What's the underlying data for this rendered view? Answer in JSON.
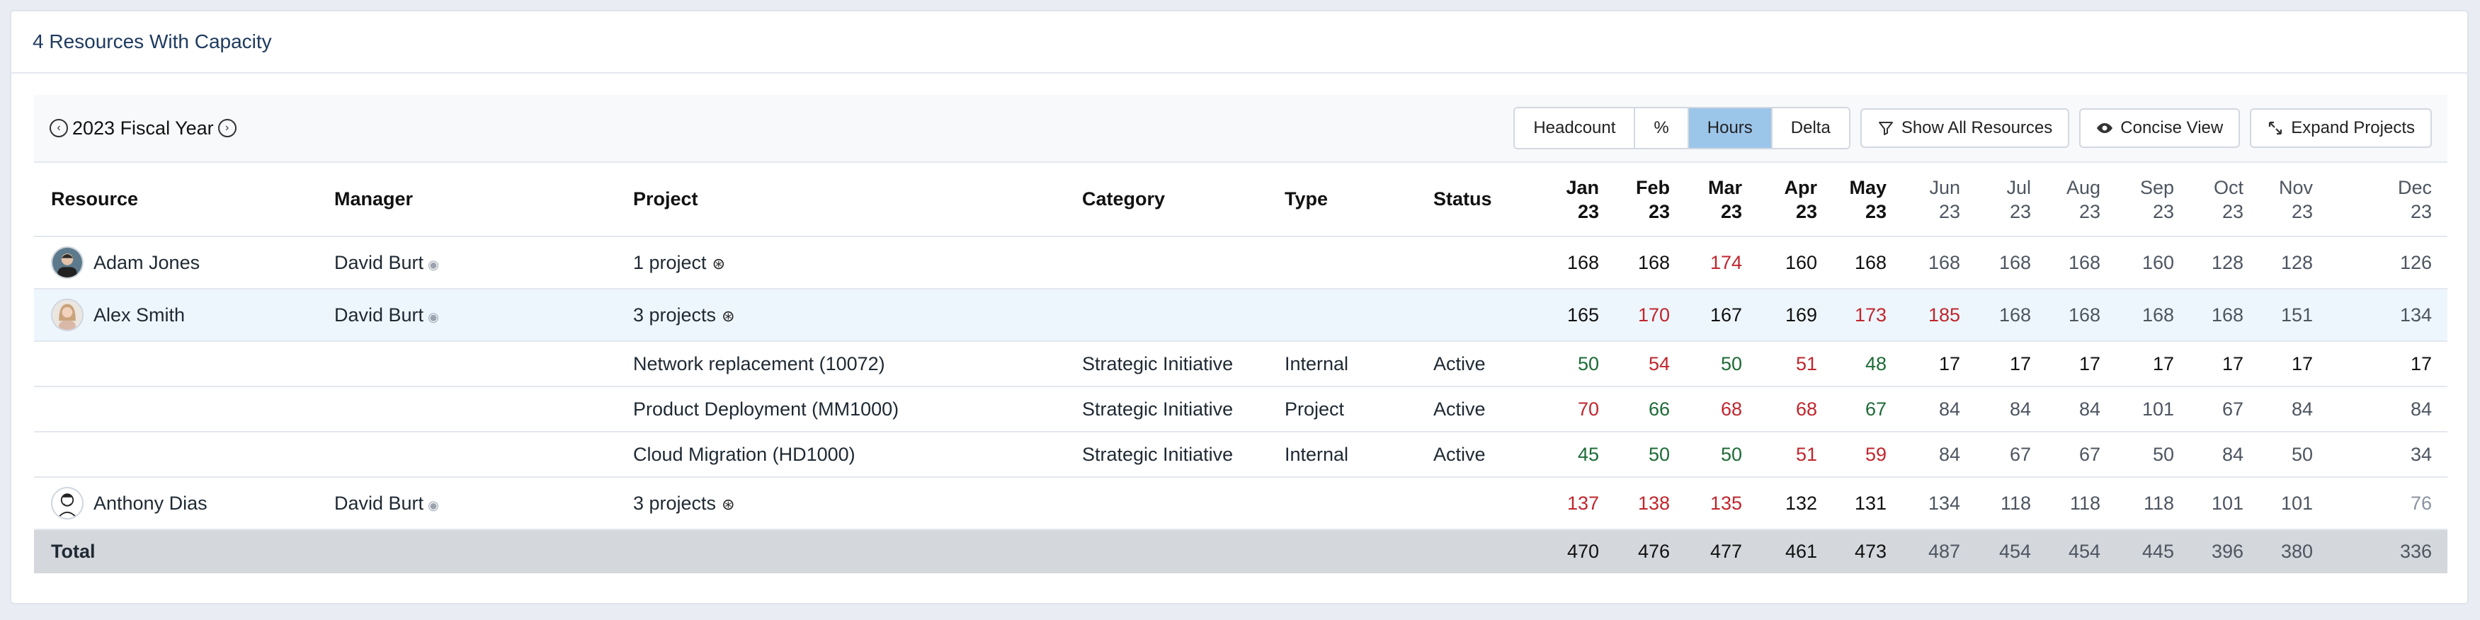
{
  "header": {
    "title": "4 Resources With Capacity"
  },
  "toolbar": {
    "fiscal_year": "2023 Fiscal Year",
    "modes": [
      "Headcount",
      "%",
      "Hours",
      "Delta"
    ],
    "active_mode": "Hours",
    "show_all": "Show All Resources",
    "concise": "Concise View",
    "expand": "Expand Projects"
  },
  "columns": {
    "resource": "Resource",
    "manager": "Manager",
    "project": "Project",
    "category": "Category",
    "type": "Type",
    "status": "Status",
    "months": [
      {
        "m": "Jan",
        "y": "23",
        "style": "bold"
      },
      {
        "m": "Feb",
        "y": "23",
        "style": "bold"
      },
      {
        "m": "Mar",
        "y": "23",
        "style": "bold"
      },
      {
        "m": "Apr",
        "y": "23",
        "style": "bold"
      },
      {
        "m": "May",
        "y": "23",
        "style": "bold"
      },
      {
        "m": "Jun",
        "y": "23",
        "style": "normal"
      },
      {
        "m": "Jul",
        "y": "23",
        "style": "normal"
      },
      {
        "m": "Aug",
        "y": "23",
        "style": "normal"
      },
      {
        "m": "Sep",
        "y": "23",
        "style": "normal"
      },
      {
        "m": "Oct",
        "y": "23",
        "style": "normal"
      },
      {
        "m": "Nov",
        "y": "23",
        "style": "normal"
      },
      {
        "m": "Dec",
        "y": "23",
        "style": "normal"
      }
    ]
  },
  "rows": [
    {
      "kind": "resource",
      "name": "Adam Jones",
      "avatar": "avatar-1",
      "manager": "David Burt",
      "project": "1 project",
      "values": [
        "168",
        "168",
        "174",
        "160",
        "168",
        "168",
        "168",
        "168",
        "160",
        "128",
        "128",
        "126"
      ],
      "colors": [
        "k",
        "k",
        "r",
        "k",
        "k",
        "g",
        "g",
        "g",
        "g",
        "g",
        "g",
        "g"
      ]
    },
    {
      "kind": "resource",
      "name": "Alex Smith",
      "avatar": "avatar-2",
      "manager": "David Burt",
      "project": "3 projects",
      "selected": true,
      "values": [
        "165",
        "170",
        "167",
        "169",
        "173",
        "185",
        "168",
        "168",
        "168",
        "168",
        "151",
        "134"
      ],
      "colors": [
        "k",
        "r",
        "k",
        "k",
        "r",
        "r",
        "g",
        "g",
        "g",
        "g",
        "g",
        "g"
      ]
    },
    {
      "kind": "project",
      "project": "Network replacement (10072)",
      "category": "Strategic Initiative",
      "type": "Internal",
      "status": "Active",
      "values": [
        "50",
        "54",
        "50",
        "51",
        "48",
        "17",
        "17",
        "17",
        "17",
        "17",
        "17",
        "17"
      ],
      "colors": [
        "gn",
        "r",
        "gn",
        "r",
        "gn",
        "k",
        "k",
        "k",
        "k",
        "k",
        "k",
        "k"
      ]
    },
    {
      "kind": "project",
      "project": "Product Deployment (MM1000)",
      "category": "Strategic Initiative",
      "type": "Project",
      "status": "Active",
      "values": [
        "70",
        "66",
        "68",
        "68",
        "67",
        "84",
        "84",
        "84",
        "101",
        "67",
        "84",
        "84"
      ],
      "colors": [
        "r",
        "gn",
        "r",
        "r",
        "gn",
        "g",
        "g",
        "g",
        "g",
        "g",
        "g",
        "g"
      ]
    },
    {
      "kind": "project",
      "project": "Cloud Migration (HD1000)",
      "category": "Strategic Initiative",
      "type": "Internal",
      "status": "Active",
      "values": [
        "45",
        "50",
        "50",
        "51",
        "59",
        "84",
        "67",
        "67",
        "50",
        "84",
        "50",
        "34"
      ],
      "colors": [
        "gn",
        "gn",
        "gn",
        "r",
        "r",
        "g",
        "g",
        "g",
        "g",
        "g",
        "g",
        "g"
      ]
    },
    {
      "kind": "resource",
      "name": "Anthony Dias",
      "avatar": "avatar-3",
      "manager": "David Burt",
      "project": "3 projects",
      "values": [
        "137",
        "138",
        "135",
        "132",
        "131",
        "134",
        "118",
        "118",
        "118",
        "101",
        "101",
        "76"
      ],
      "colors": [
        "r",
        "r",
        "r",
        "k",
        "k",
        "g",
        "g",
        "g",
        "g",
        "g",
        "g",
        "lg"
      ]
    }
  ],
  "total": {
    "label": "Total",
    "values": [
      "470",
      "476",
      "477",
      "461",
      "473",
      "487",
      "454",
      "454",
      "445",
      "396",
      "380",
      "336"
    ],
    "colors": [
      "k",
      "k",
      "k",
      "k",
      "k",
      "g",
      "g",
      "g",
      "g",
      "g",
      "g",
      "g"
    ]
  },
  "palette": {
    "red": "#c0262d",
    "green": "#1d6b37",
    "active_mode": "#9cc5ea",
    "selected_row": "#eef6fd",
    "total_row": "#d4d7dc"
  }
}
